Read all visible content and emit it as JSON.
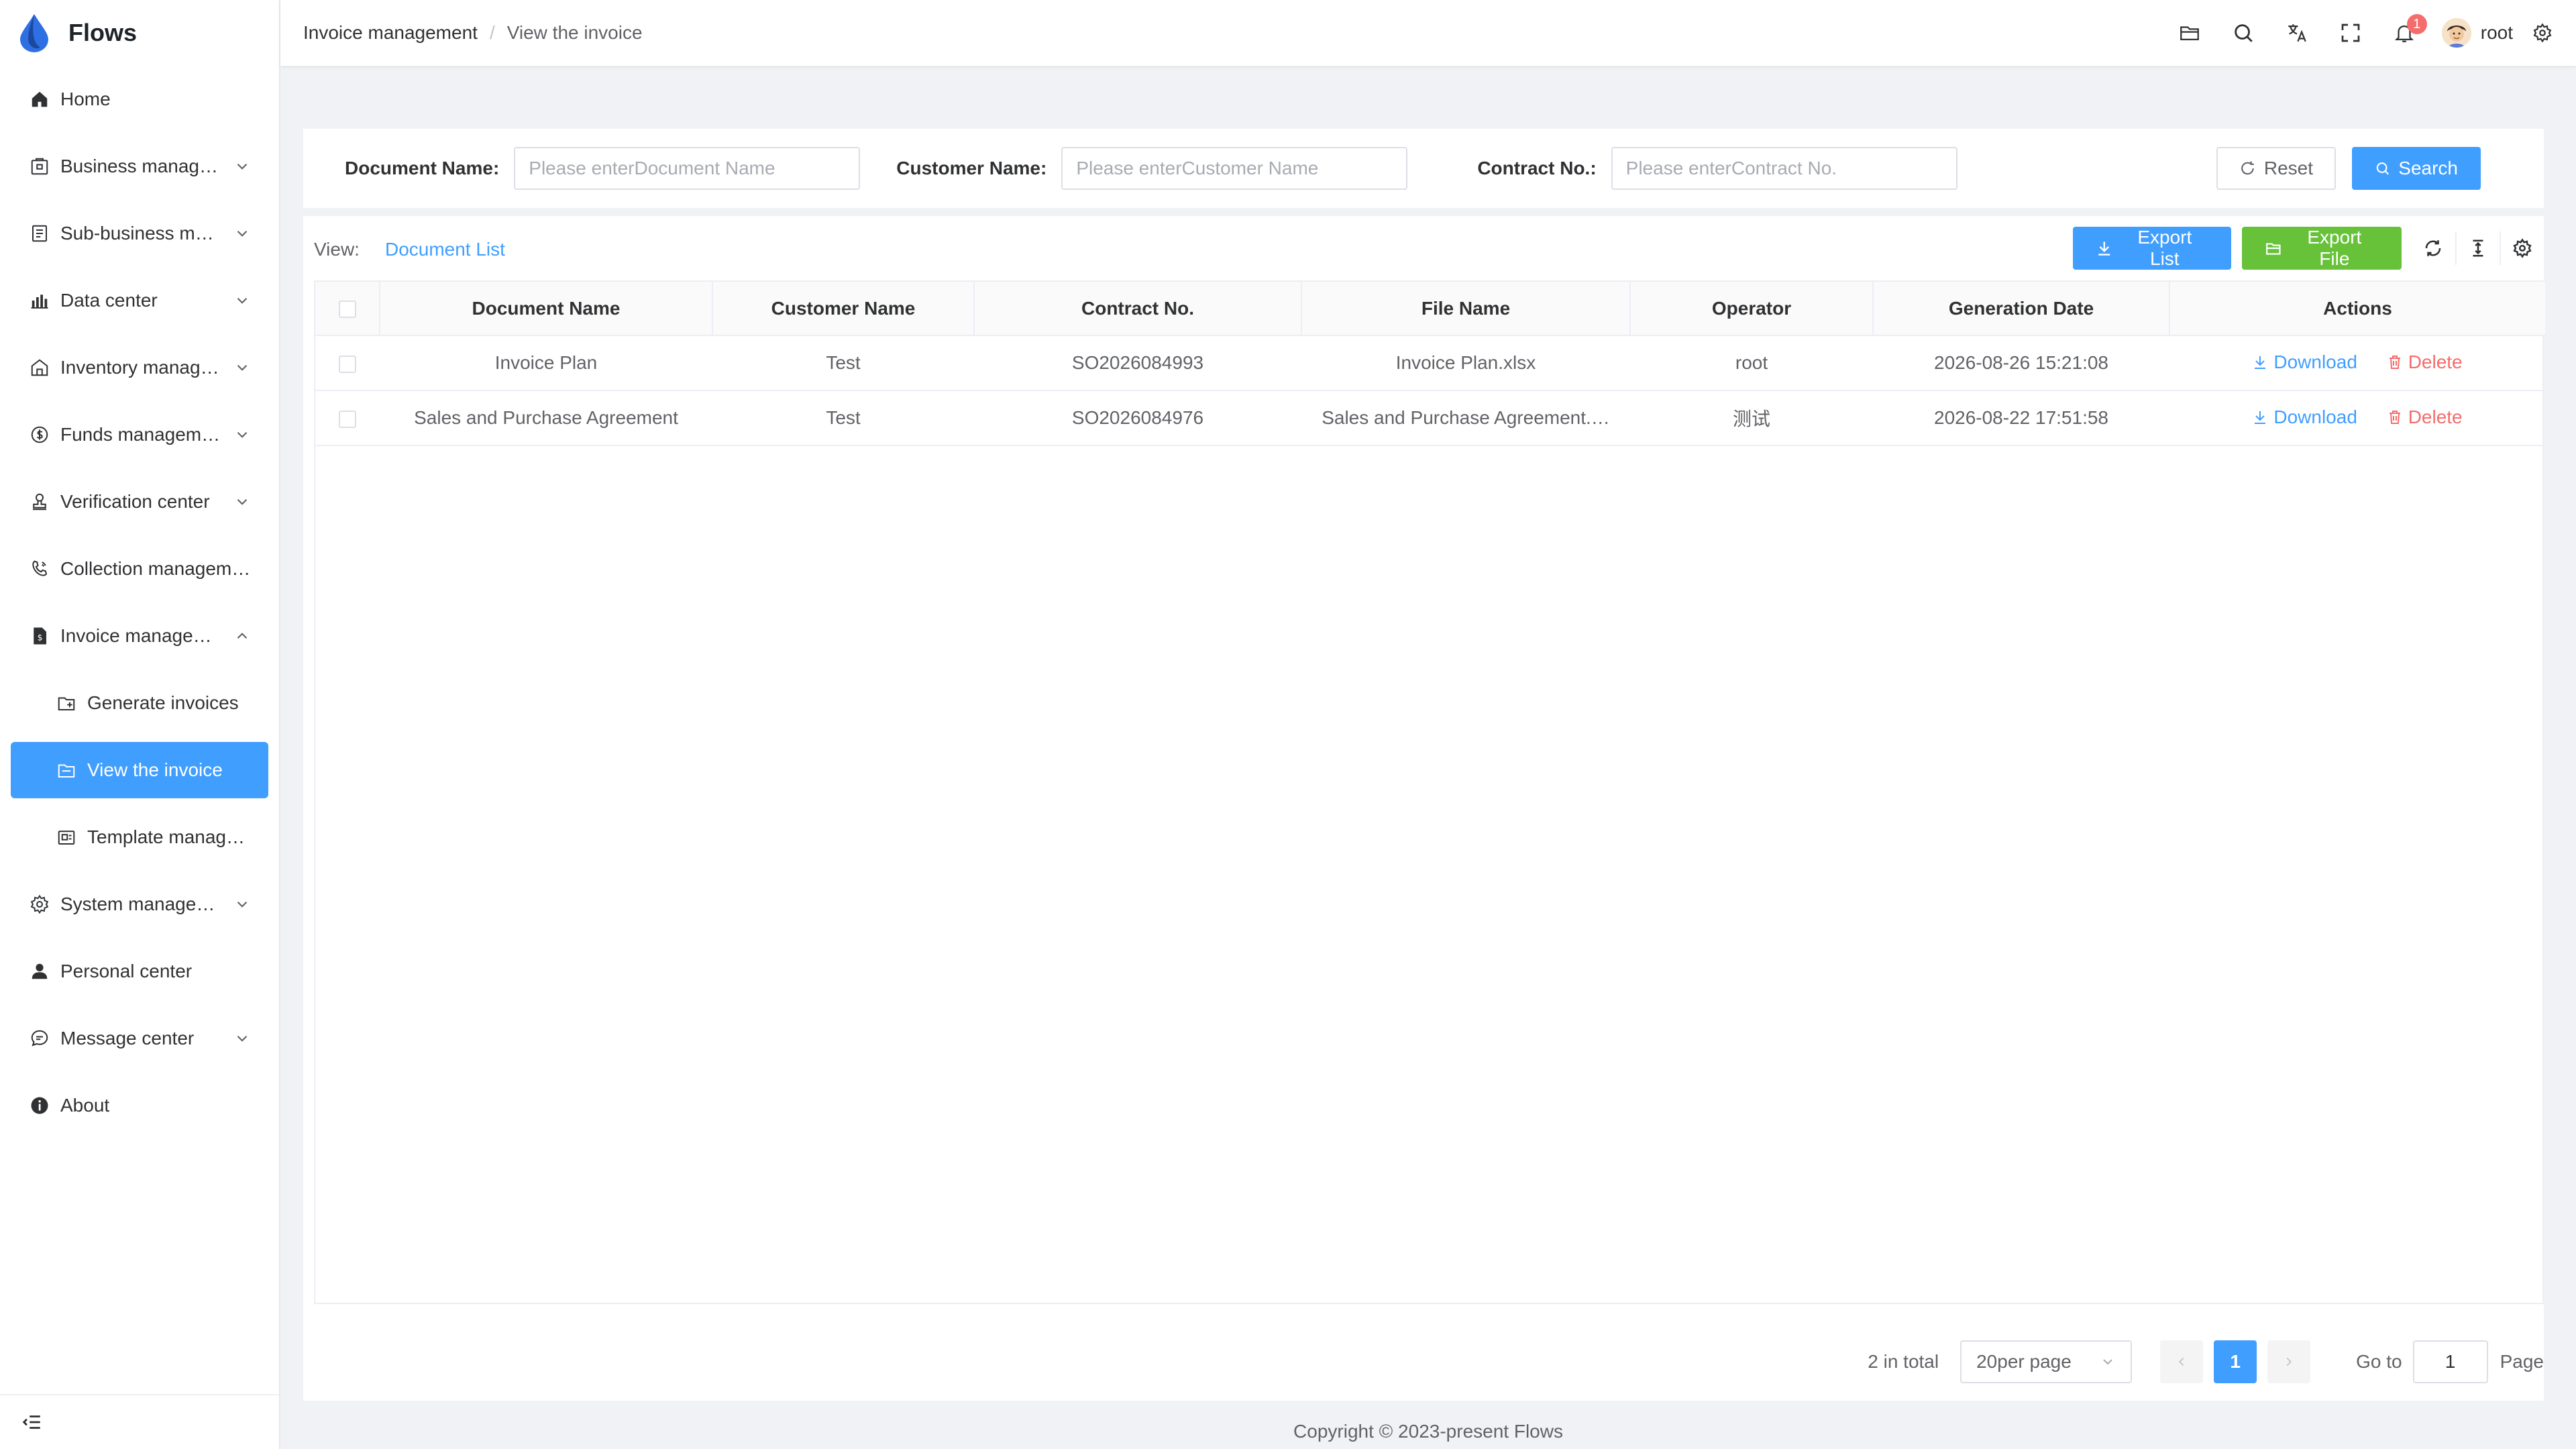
{
  "app": {
    "name": "Flows"
  },
  "sidebar": {
    "items": [
      {
        "label": "Home",
        "icon": "home-icon"
      },
      {
        "label": "Business manag…",
        "icon": "briefcase-icon"
      },
      {
        "label": "Sub-business m…",
        "icon": "document-list-icon"
      },
      {
        "label": "Data center",
        "icon": "bar-chart-icon"
      },
      {
        "label": "Inventory manag…",
        "icon": "warehouse-icon"
      },
      {
        "label": "Funds managem…",
        "icon": "coin-icon"
      },
      {
        "label": "Verification center",
        "icon": "stamp-icon"
      },
      {
        "label": "Collection managem…",
        "icon": "phone-icon"
      },
      {
        "label": "Invoice manage…",
        "icon": "invoice-icon"
      },
      {
        "label": "Generate invoices",
        "icon": "folder-add-icon"
      },
      {
        "label": "View the invoice",
        "icon": "folder-open-icon"
      },
      {
        "label": "Template manage…",
        "icon": "template-icon"
      },
      {
        "label": "System manage…",
        "icon": "gear-icon"
      },
      {
        "label": "Personal center",
        "icon": "user-icon"
      },
      {
        "label": "Message center",
        "icon": "chat-icon"
      },
      {
        "label": "About",
        "icon": "info-icon"
      }
    ]
  },
  "header": {
    "breadcrumb": [
      "Invoice management",
      "View the invoice"
    ],
    "breadcrumb_separator": "/",
    "notification_count": "1",
    "username": "root"
  },
  "search": {
    "document_name": {
      "label": "Document Name:",
      "placeholder": "Please enterDocument Name"
    },
    "customer_name": {
      "label": "Customer Name:",
      "placeholder": "Please enterCustomer Name"
    },
    "contract_no": {
      "label": "Contract No.:",
      "placeholder": "Please enterContract No."
    },
    "reset_label": "Reset",
    "search_label": "Search"
  },
  "toolbar": {
    "view_label": "View:",
    "view_link": "Document List",
    "export_list": "Export List",
    "export_file": "Export File"
  },
  "table": {
    "columns": [
      "Document Name",
      "Customer Name",
      "Contract No.",
      "File Name",
      "Operator",
      "Generation Date",
      "Actions"
    ],
    "rows": [
      {
        "document_name": "Invoice Plan",
        "customer_name": "Test",
        "contract_no": "SO2026084993",
        "file_name": "Invoice Plan.xlsx",
        "operator": "root",
        "generation_date": "2026-08-26 15:21:08"
      },
      {
        "document_name": "Sales and Purchase Agreement",
        "customer_name": "Test",
        "contract_no": "SO2026084976",
        "file_name": "Sales and Purchase Agreement.…",
        "operator": "测试",
        "generation_date": "2026-08-22 17:51:58"
      }
    ],
    "download_label": "Download",
    "delete_label": "Delete"
  },
  "pagination": {
    "total": "2 in total",
    "page_size": "20per page",
    "current_page": "1",
    "goto_label": "Go to",
    "goto_value": "1",
    "page_label": "Page"
  },
  "footer": {
    "copyright": "Copyright © 2023-present Flows"
  },
  "colors": {
    "primary": "#409eff",
    "success": "#67c23a",
    "danger": "#f56c6c"
  }
}
